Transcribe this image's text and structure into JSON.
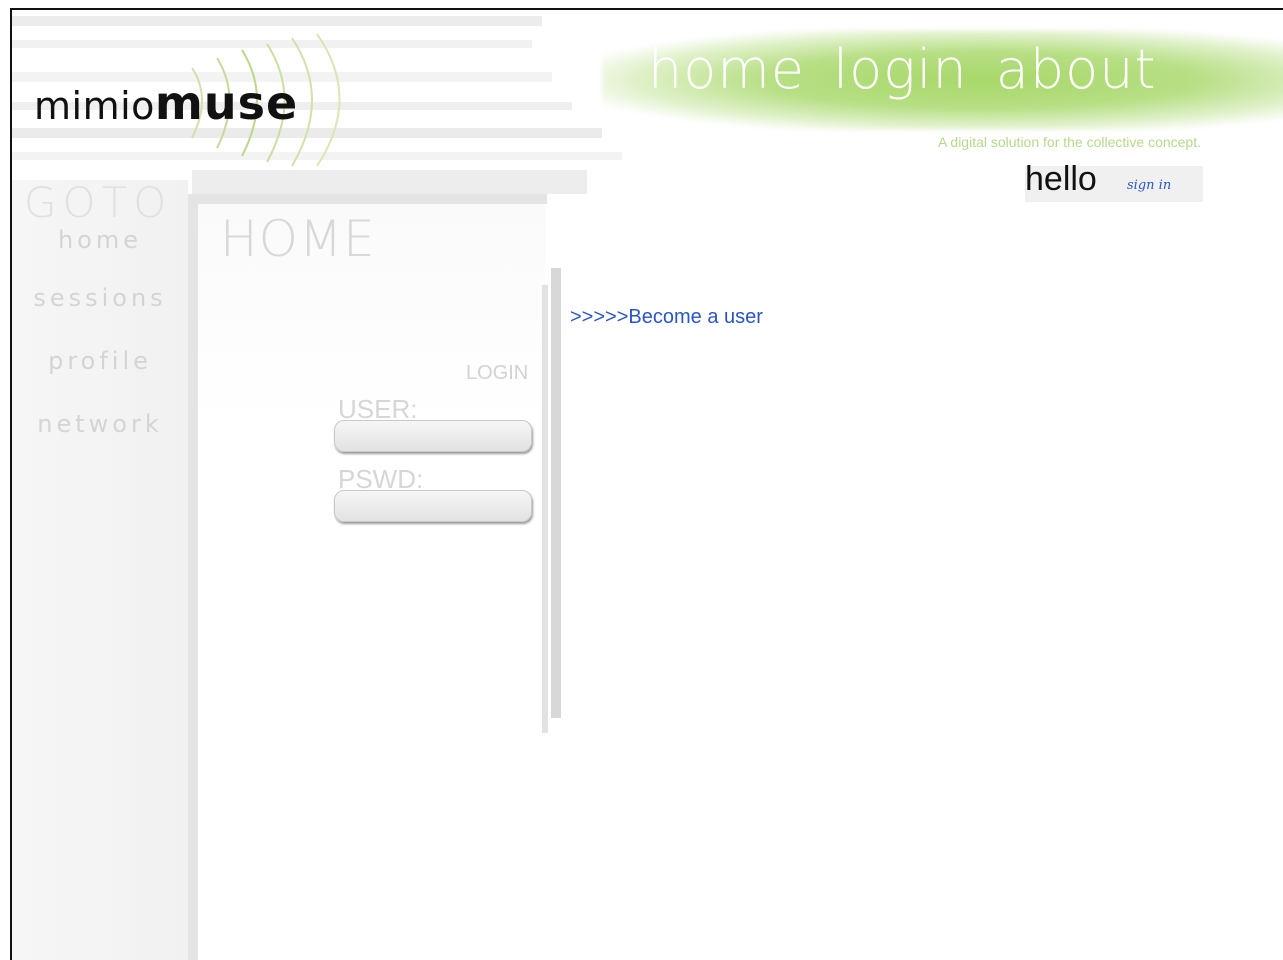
{
  "brand": {
    "prefix": "mimio",
    "name": "muse"
  },
  "top_nav": [
    {
      "label": "home"
    },
    {
      "label": "login"
    },
    {
      "label": "about"
    }
  ],
  "tagline": "A digital solution for the collective concept.",
  "greeting": {
    "hello": "hello",
    "sign_in": "sign in"
  },
  "sidebar": {
    "heading": "GOTO",
    "items": [
      {
        "label": "home"
      },
      {
        "label": "sessions"
      },
      {
        "label": "profile"
      },
      {
        "label": "network"
      }
    ]
  },
  "main": {
    "title": "HOME",
    "login_label": "LOGIN",
    "user_label": "USER:",
    "pswd_label": "PSWD:",
    "user_value": "",
    "pswd_value": "",
    "become_user_link": ">>>>>Become a user"
  },
  "colors": {
    "accent_green": "#a8d86a",
    "link_blue": "#2a55c8",
    "tagline_green": "#b5d98a"
  }
}
